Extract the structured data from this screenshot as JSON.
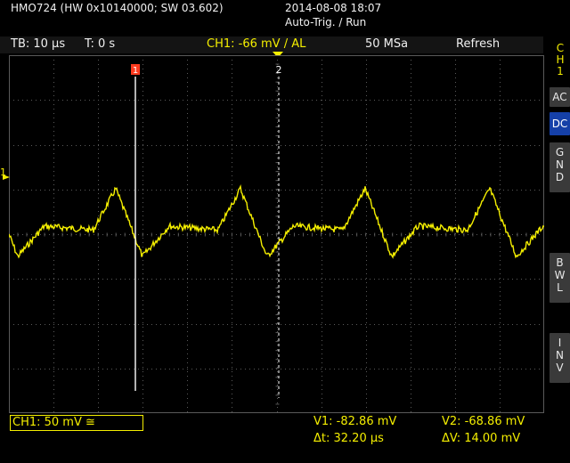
{
  "device": {
    "model_info": "HMO724 (HW 0x10140000; SW 03.602)",
    "datetime": "2014-08-08 18:07",
    "trigger_state": "Auto-Trig. / Run"
  },
  "status_bar": {
    "timebase": "TB: 10 µs",
    "trigger_time": "T: 0 s",
    "ch1_trigger": "CH1: -66 mV / AL",
    "sample_rate": "50 MSa",
    "mode": "Refresh"
  },
  "side_panel": {
    "channel_label_1": "C",
    "channel_label_2": "H",
    "channel_label_3": "1",
    "coupling_ac": "AC",
    "coupling_dc": "DC",
    "gnd_1": "G",
    "gnd_2": "N",
    "gnd_3": "D",
    "bwl_1": "B",
    "bwl_2": "W",
    "bwl_3": "L",
    "inv_1": "I",
    "inv_2": "N",
    "inv_3": "V"
  },
  "screen": {
    "cursor1_label": "1",
    "cursor2_label": "2",
    "channel_marker": "1"
  },
  "bottom": {
    "ch1_scale": "CH1: 50 mV ≅",
    "v1": "V1: -82.86 mV",
    "v2": "V2: -68.86 mV",
    "dt": "Δt: 32.20 µs",
    "dv": "ΔV: 14.00 mV"
  },
  "colors": {
    "trace": "#f4ee00",
    "grid": "#5a5a5a",
    "active_button": "#1540a8",
    "cursor1": "#ff3b1f"
  }
}
